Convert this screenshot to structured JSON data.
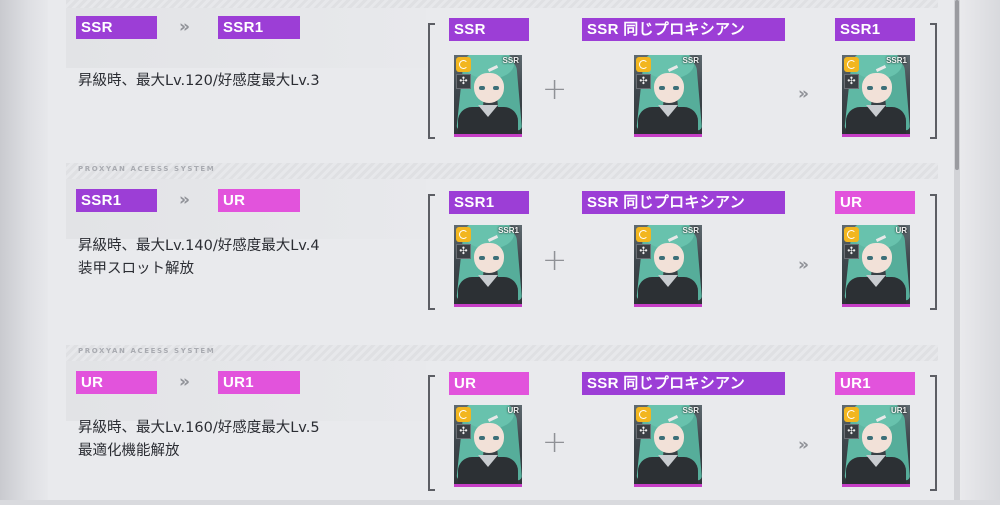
{
  "system_label": "PROXYAN ACEESS SYSTEM",
  "plus_glyph": "+",
  "chevron_glyph": "»",
  "card_icon": {
    "class_icon": "class-badge-icon",
    "position_icon": "crosshair-icon",
    "position_glyph": "✣"
  },
  "colors": {
    "ssr": "#9c3ed6",
    "ur": "#e253dc"
  },
  "sections": [
    {
      "from": "SSR",
      "to": "SSR1",
      "desc": [
        "昇級時、最大Lv.120/好感度最大Lv.3"
      ],
      "material_a": {
        "label": "SSR",
        "card_rank": "SSR"
      },
      "material_b": {
        "label": "SSR 同じプロキシアン",
        "card_rank": "SSR"
      },
      "result": {
        "label": "SSR1",
        "card_rank": "SSR1"
      }
    },
    {
      "from": "SSR1",
      "to": "UR",
      "desc": [
        "昇級時、最大Lv.140/好感度最大Lv.4",
        "装甲スロット解放"
      ],
      "material_a": {
        "label": "SSR1",
        "card_rank": "SSR1"
      },
      "material_b": {
        "label": "SSR 同じプロキシアン",
        "card_rank": "SSR"
      },
      "result": {
        "label": "UR",
        "card_rank": "UR"
      }
    },
    {
      "from": "UR",
      "to": "UR1",
      "desc": [
        "昇級時、最大Lv.160/好感度最大Lv.5",
        "最適化機能解放"
      ],
      "material_a": {
        "label": "UR",
        "card_rank": "UR"
      },
      "material_b": {
        "label": "SSR 同じプロキシアン",
        "card_rank": "SSR"
      },
      "result": {
        "label": "UR1",
        "card_rank": "UR1"
      }
    }
  ]
}
